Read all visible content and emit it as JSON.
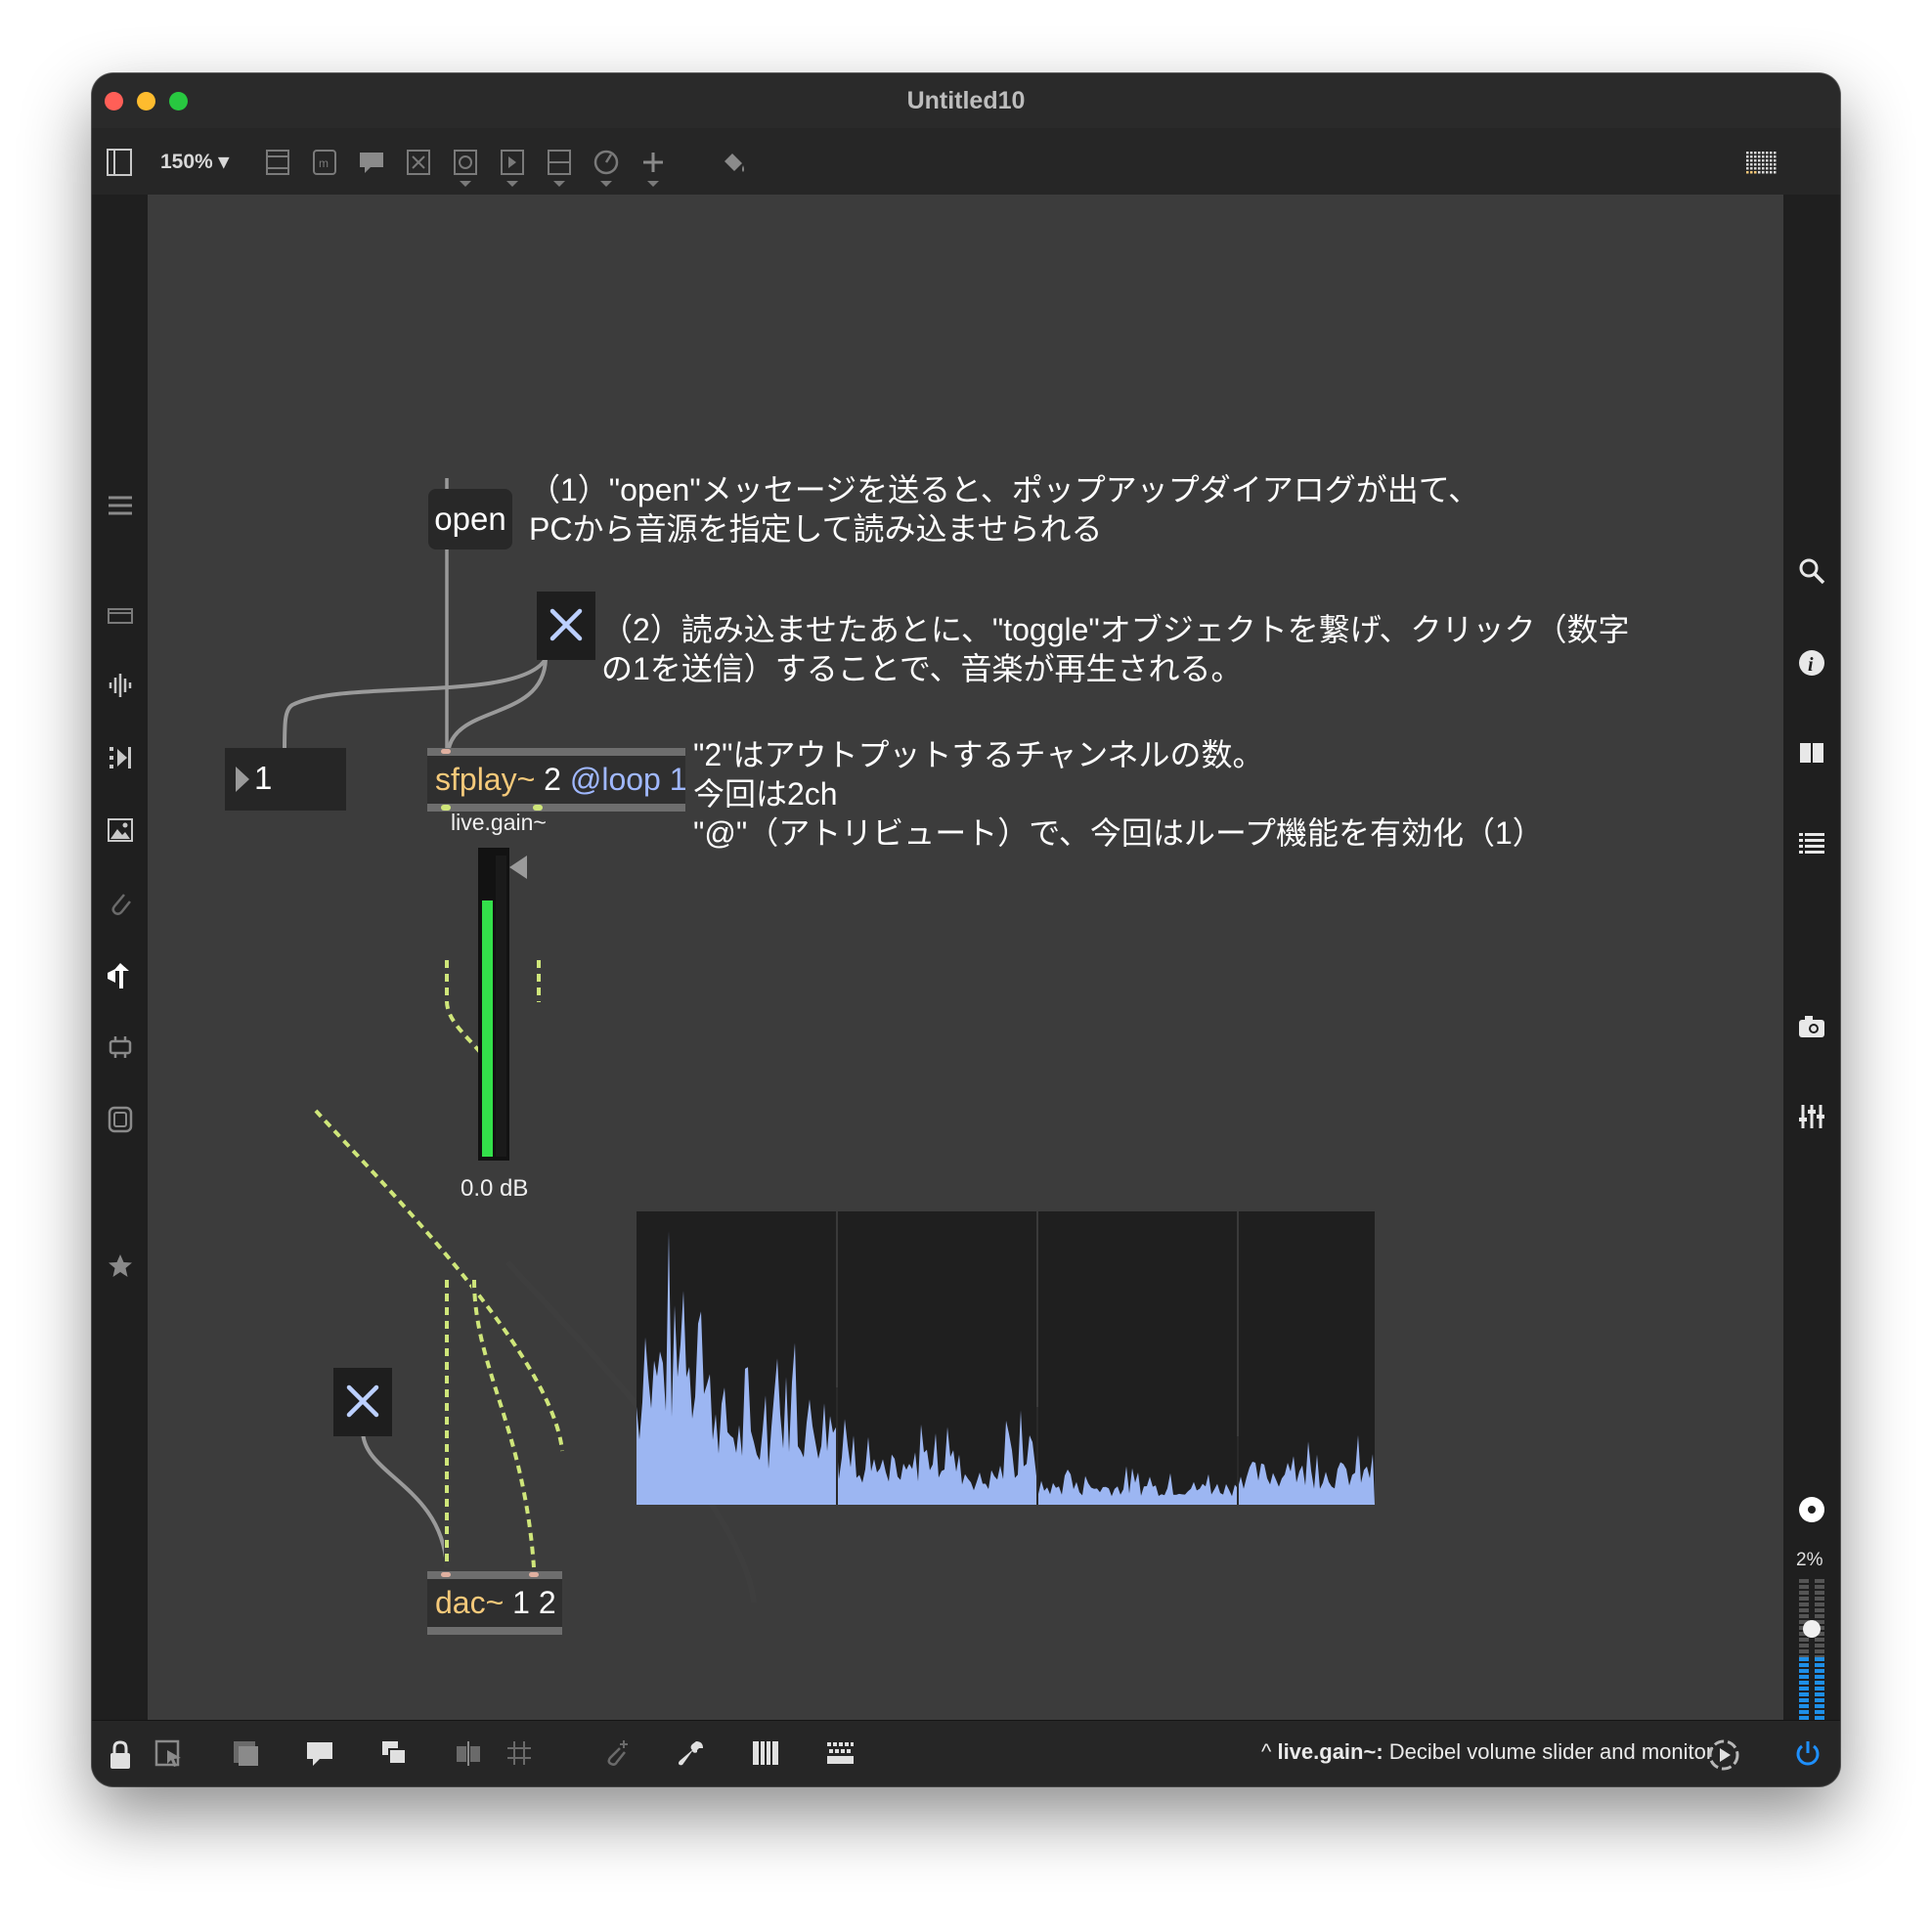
{
  "window": {
    "title": "Untitled10"
  },
  "toolbar": {
    "zoom": "150% ▾",
    "icons": [
      "sidebar-toggle-icon",
      "newobject-icon",
      "message-icon",
      "comment-icon",
      "toggle-icon",
      "button-icon",
      "number-icon",
      "slider-icon",
      "dial-icon",
      "add-icon",
      "paint-bucket-icon",
      "grid-icon"
    ]
  },
  "patch": {
    "open_message": "open",
    "comment1": "（1）\"open\"メッセージを送ると、ポップアップダイアログが出て、\nPCから音源を指定して読み込ませられる",
    "comment2": "（2）読み込ませたあとに、\"toggle\"オブジェクトを繋げ、クリック（数字\nの1を送信）することで、音楽が再生される。",
    "comment3": "\"2\"はアウトプットするチャンネルの数。\n今回は2ch\n\"@\"（アトリビュート）で、今回はループ機能を有効化（1）",
    "number_value": "1",
    "sfplay": {
      "name": "sfplay~",
      "args": "2",
      "attr": "@loop",
      "attr_value": "1"
    },
    "gain": {
      "label": "live.gain~",
      "value": "0.0 dB",
      "level": 0.85
    },
    "dac": {
      "name": "dac~",
      "args": "1 2"
    }
  },
  "status": {
    "prefix": "^",
    "object": "live.gain~:",
    "description": "Decibel volume slider and monitor"
  },
  "right_sidebar": {
    "audio_percent": "2%"
  },
  "colors": {
    "canvas": "#3c3c3c",
    "object_name": "#f5c97a",
    "attribute": "#a0b8ff",
    "toggle_x": "#bcd0ff",
    "signal_cord": "#cfe67a",
    "meter_green": "#33e04a",
    "scope_fill": "#9cb6f2",
    "power": "#1e90ff"
  }
}
